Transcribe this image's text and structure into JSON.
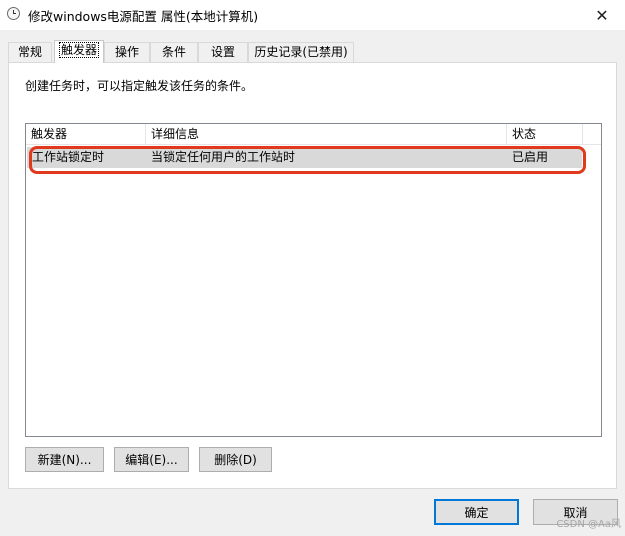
{
  "window": {
    "title": "修改windows电源配置 属性(本地计算机)",
    "close_glyph": "✕"
  },
  "tabs": [
    {
      "label": "常规",
      "active": false
    },
    {
      "label": "触发器",
      "active": true
    },
    {
      "label": "操作",
      "active": false
    },
    {
      "label": "条件",
      "active": false
    },
    {
      "label": "设置",
      "active": false
    },
    {
      "label": "历史记录(已禁用)",
      "active": false
    }
  ],
  "triggers": {
    "description": "创建任务时，可以指定触发该任务的条件。",
    "columns": [
      "触发器",
      "详细信息",
      "状态"
    ],
    "rows": [
      {
        "trigger": "工作站锁定时",
        "details": "当锁定任何用户的工作站时",
        "status": "已启用"
      }
    ],
    "buttons": {
      "new": "新建(N)...",
      "edit": "编辑(E)...",
      "delete": "删除(D)"
    }
  },
  "footer": {
    "ok": "确定",
    "cancel": "取消"
  },
  "watermark": "CSDN @Aa风",
  "colors": {
    "highlight": "#e03a1e",
    "default_button_border": "#0078d7",
    "selected_row": "#d9d9d9"
  }
}
